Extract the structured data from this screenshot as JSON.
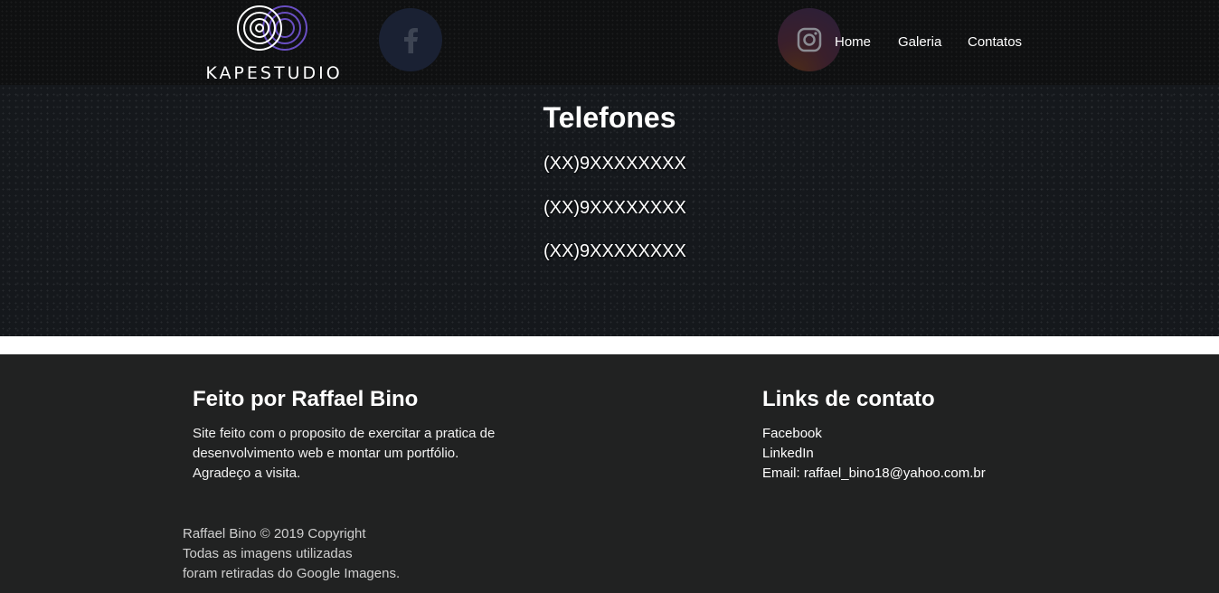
{
  "header": {
    "logo_text": "KAPESTUDIO",
    "social": [
      {
        "icon": "facebook-icon"
      },
      {
        "icon": "instagram-icon"
      }
    ],
    "nav": [
      "Home",
      "Galeria",
      "Contatos"
    ]
  },
  "main": {
    "title": "Telefones",
    "phones": [
      "(XX)9XXXXXXXX",
      "(XX)9XXXXXXXX",
      "(XX)9XXXXXXXX"
    ]
  },
  "footer": {
    "about": {
      "title": "Feito por Raffael Bino",
      "lines": [
        "Site feito com o proposito de exercitar a pratica de",
        "desenvolvimento web e montar um portfólio.",
        "Agradeço a visita."
      ]
    },
    "contact": {
      "title": "Links de contato",
      "links": [
        "Facebook",
        "LinkedIn"
      ],
      "email": "Email: raffael_bino18@yahoo.com.br"
    },
    "copyright": [
      "Raffael Bino © 2019 Copyright",
      "Todas as imagens utilizadas",
      "foram retiradas do Google Imagens."
    ]
  },
  "colors": {
    "header_bg": "#0f1011",
    "main_bg": "#15181c",
    "footer_bg": "#212222",
    "logo_purple": "#6a4fc4",
    "facebook_circle": "#1a2133"
  }
}
